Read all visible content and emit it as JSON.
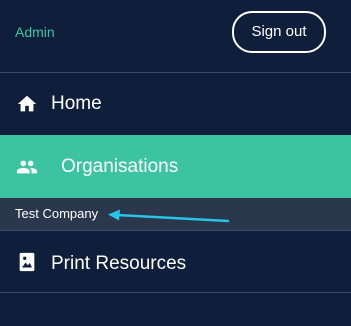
{
  "header": {
    "role_label": "Admin",
    "sign_out_label": "Sign out"
  },
  "nav": {
    "items": [
      {
        "label": "Home",
        "icon": "home-icon"
      },
      {
        "label": "Organisations",
        "icon": "people-icon"
      },
      {
        "label": "Print Resources",
        "icon": "picture-icon"
      }
    ],
    "sub_items": [
      {
        "label": "Test Company"
      }
    ]
  },
  "colors": {
    "background": "#0f1e3a",
    "accent": "#3cc4a2",
    "subnav_background": "#2a374c",
    "annotation_arrow": "#27c3e8"
  }
}
